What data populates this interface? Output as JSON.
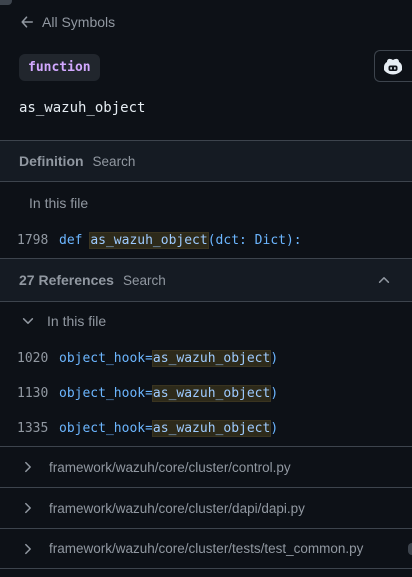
{
  "nav": {
    "back_label": "All Symbols"
  },
  "symbol": {
    "kind": "function",
    "name": "as_wazuh_object"
  },
  "definition": {
    "title": "Definition",
    "search_label": "Search",
    "scope": "In this file",
    "line_no": "1798",
    "keyword": "def",
    "name": "as_wazuh_object",
    "rest": "(dct: Dict):"
  },
  "references": {
    "title": "27 References",
    "search_label": "Search",
    "scope": "In this file",
    "lines": [
      {
        "line_no": "1020",
        "prefix": "object_hook=",
        "match": "as_wazuh_object",
        "suffix": ")"
      },
      {
        "line_no": "1130",
        "prefix": "object_hook=",
        "match": "as_wazuh_object",
        "suffix": ")"
      },
      {
        "line_no": "1335",
        "prefix": "object_hook=",
        "match": "as_wazuh_object",
        "suffix": ")"
      }
    ],
    "files": [
      {
        "path": "framework/wazuh/core/cluster/control.py"
      },
      {
        "path": "framework/wazuh/core/cluster/dapi/dapi.py"
      },
      {
        "path": "framework/wazuh/core/cluster/tests/test_common.py"
      }
    ]
  },
  "colors": {
    "background": "#0d1117",
    "header_bg": "#151b23",
    "border": "#3d444d",
    "muted_text": "#9198a1",
    "keyword_blue": "#6cb6ff",
    "badge_purple": "#d2a8ff",
    "match_highlight": "#2d2a1a"
  },
  "icons": {
    "back": "arrow-left-icon",
    "copilot": "copilot-icon",
    "collapse": "chevron-up-icon",
    "expand": "chevron-down-icon",
    "file_collapsed": "chevron-right-icon"
  }
}
